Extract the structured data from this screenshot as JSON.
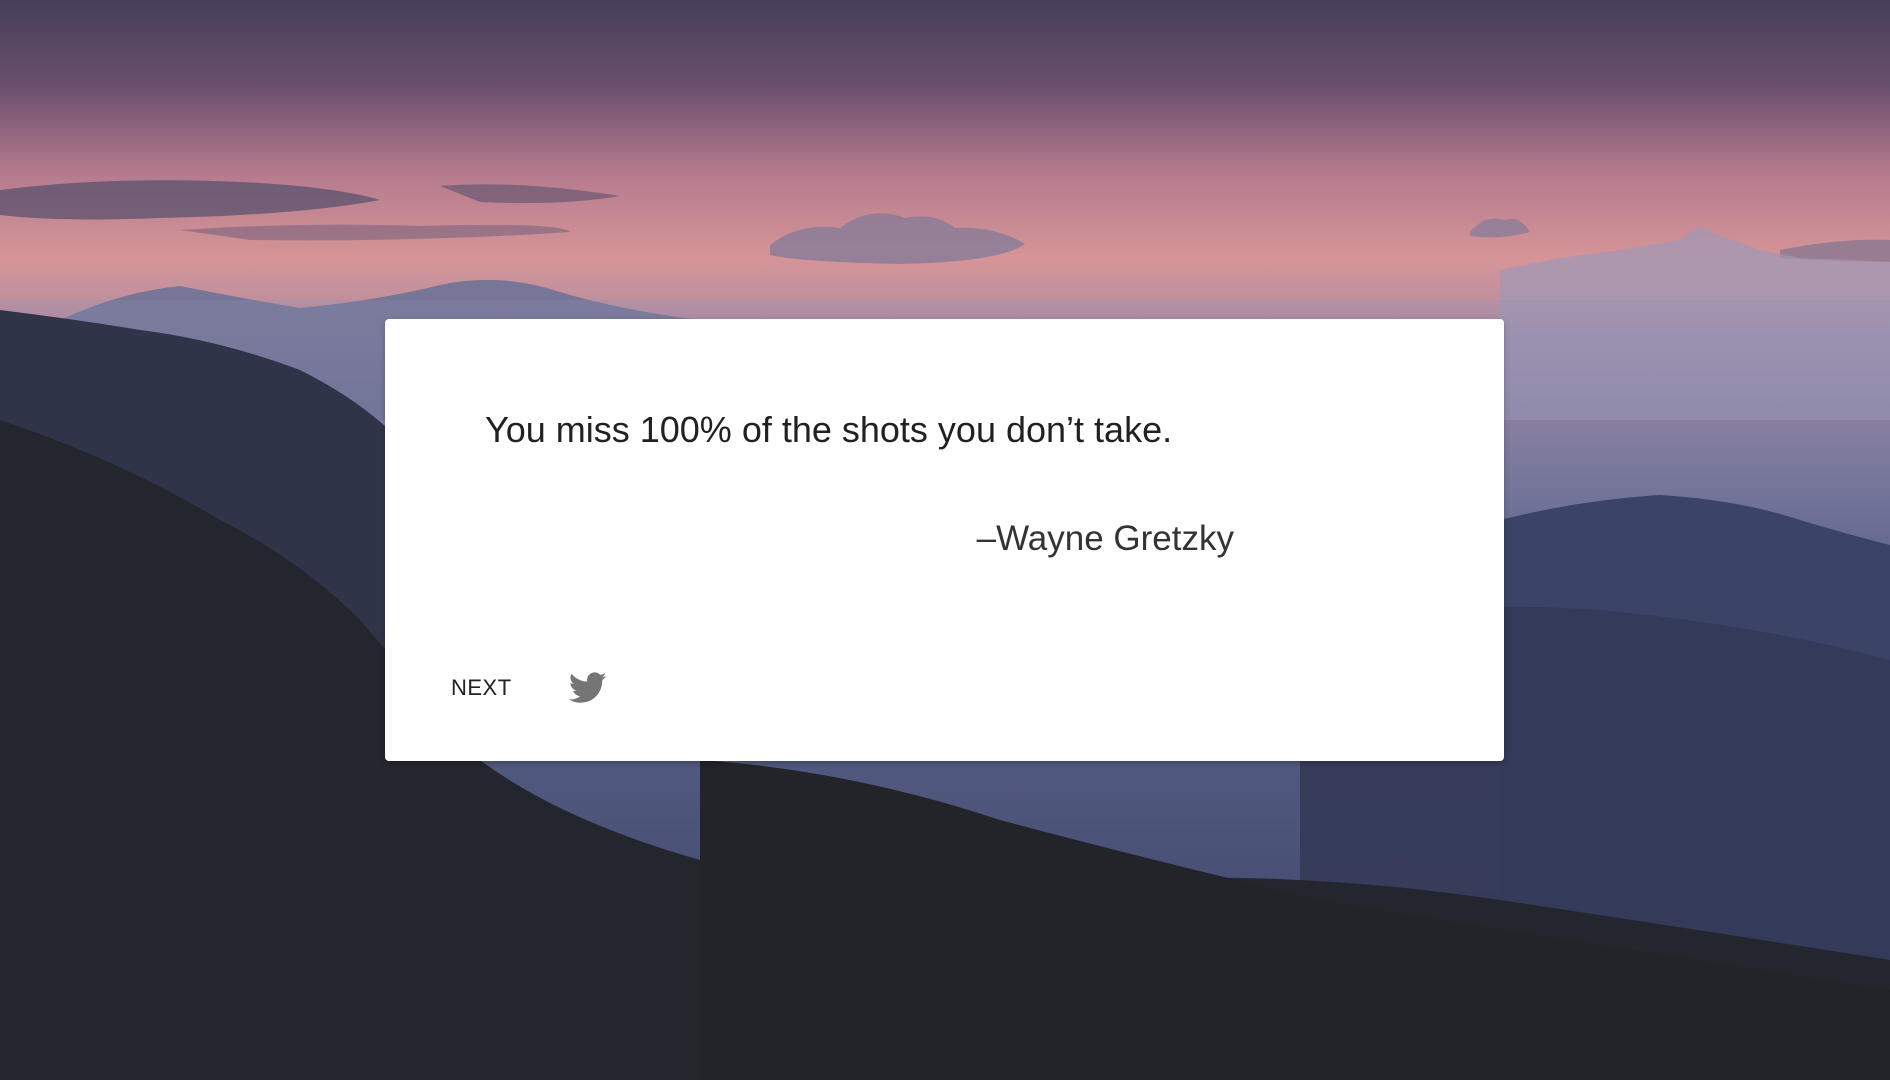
{
  "quote": {
    "text": "You miss 100% of the shots you don’t take.",
    "author": "–Wayne Gretzky"
  },
  "actions": {
    "next_label": "NEXT",
    "tweet_icon": "twitter-bird-icon"
  },
  "colors": {
    "sky_top": "#4a4460",
    "sky_glow": "#d9929a",
    "mountain_far": "#6b6f92",
    "mountain_mid": "#3c4466",
    "foreground": "#222429",
    "card_bg": "#ffffff",
    "quote_text": "#212121",
    "icon": "#757575"
  }
}
